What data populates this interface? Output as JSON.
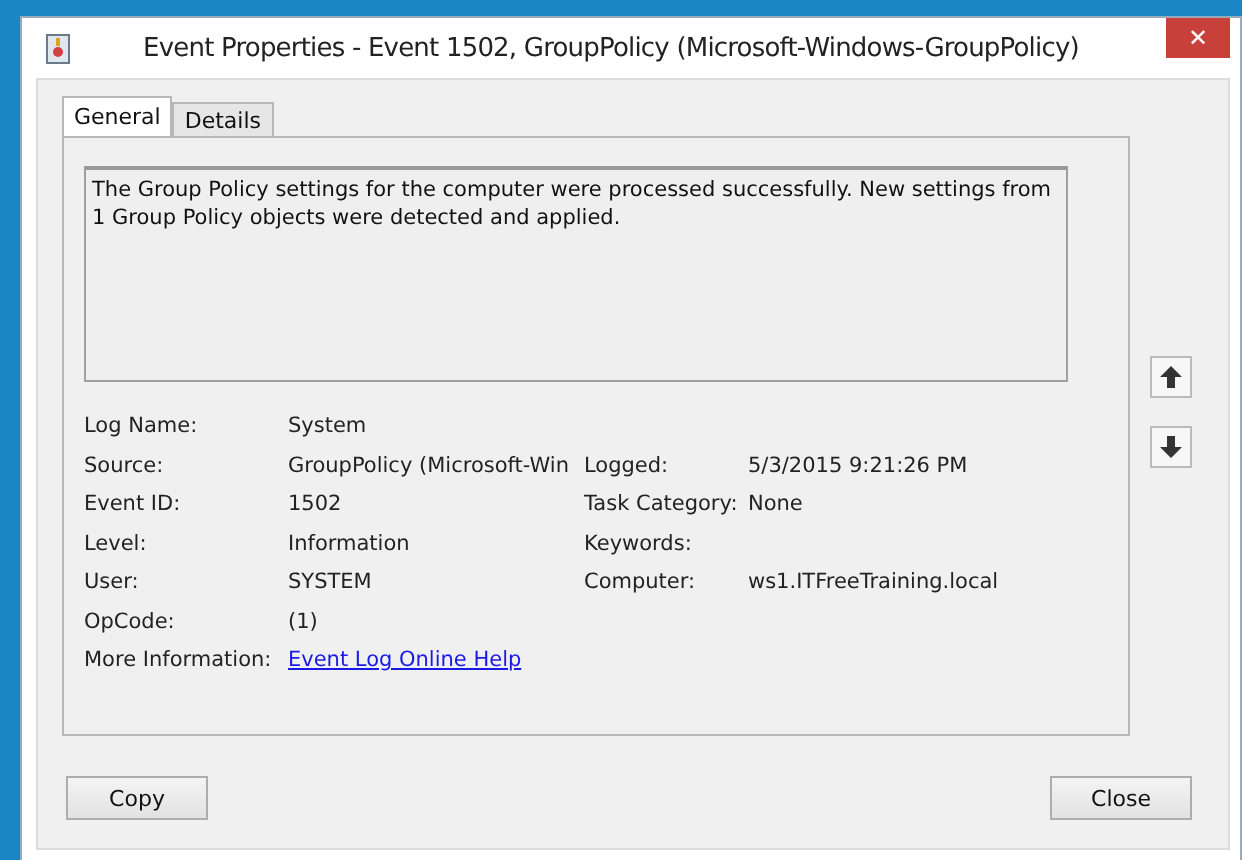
{
  "window": {
    "title": "Event Properties - Event 1502, GroupPolicy (Microsoft-Windows-GroupPolicy)",
    "close": "✕"
  },
  "tabs": [
    {
      "label": "General",
      "selected": true
    },
    {
      "label": "Details",
      "selected": false
    }
  ],
  "message": "The Group Policy settings for the computer were processed successfully. New settings from 1 Group Policy objects were detected and applied.",
  "properties": [
    {
      "label": "Log Name:",
      "value": "System"
    },
    {
      "label": "Source:",
      "value": "GroupPolicy (Microsoft-Win",
      "label_2": "Logged:",
      "value_2": "5/3/2015 9:21:26 PM"
    },
    {
      "label": "Event ID:",
      "value": "1502",
      "label_2": "Task Category:",
      "value_2": "None"
    },
    {
      "label": "Level:",
      "value": "Information",
      "label_2": "Keywords:"
    },
    {
      "label": "User:",
      "value": "SYSTEM",
      "label_2": "Computer:",
      "value_2": "ws1.ITFreeTraining.local"
    },
    {
      "label": "OpCode:",
      "value": "(1)"
    },
    {
      "label": "More Information:",
      "link": "Event Log Online Help"
    }
  ],
  "buttons": [
    "Copy",
    "Close"
  ]
}
